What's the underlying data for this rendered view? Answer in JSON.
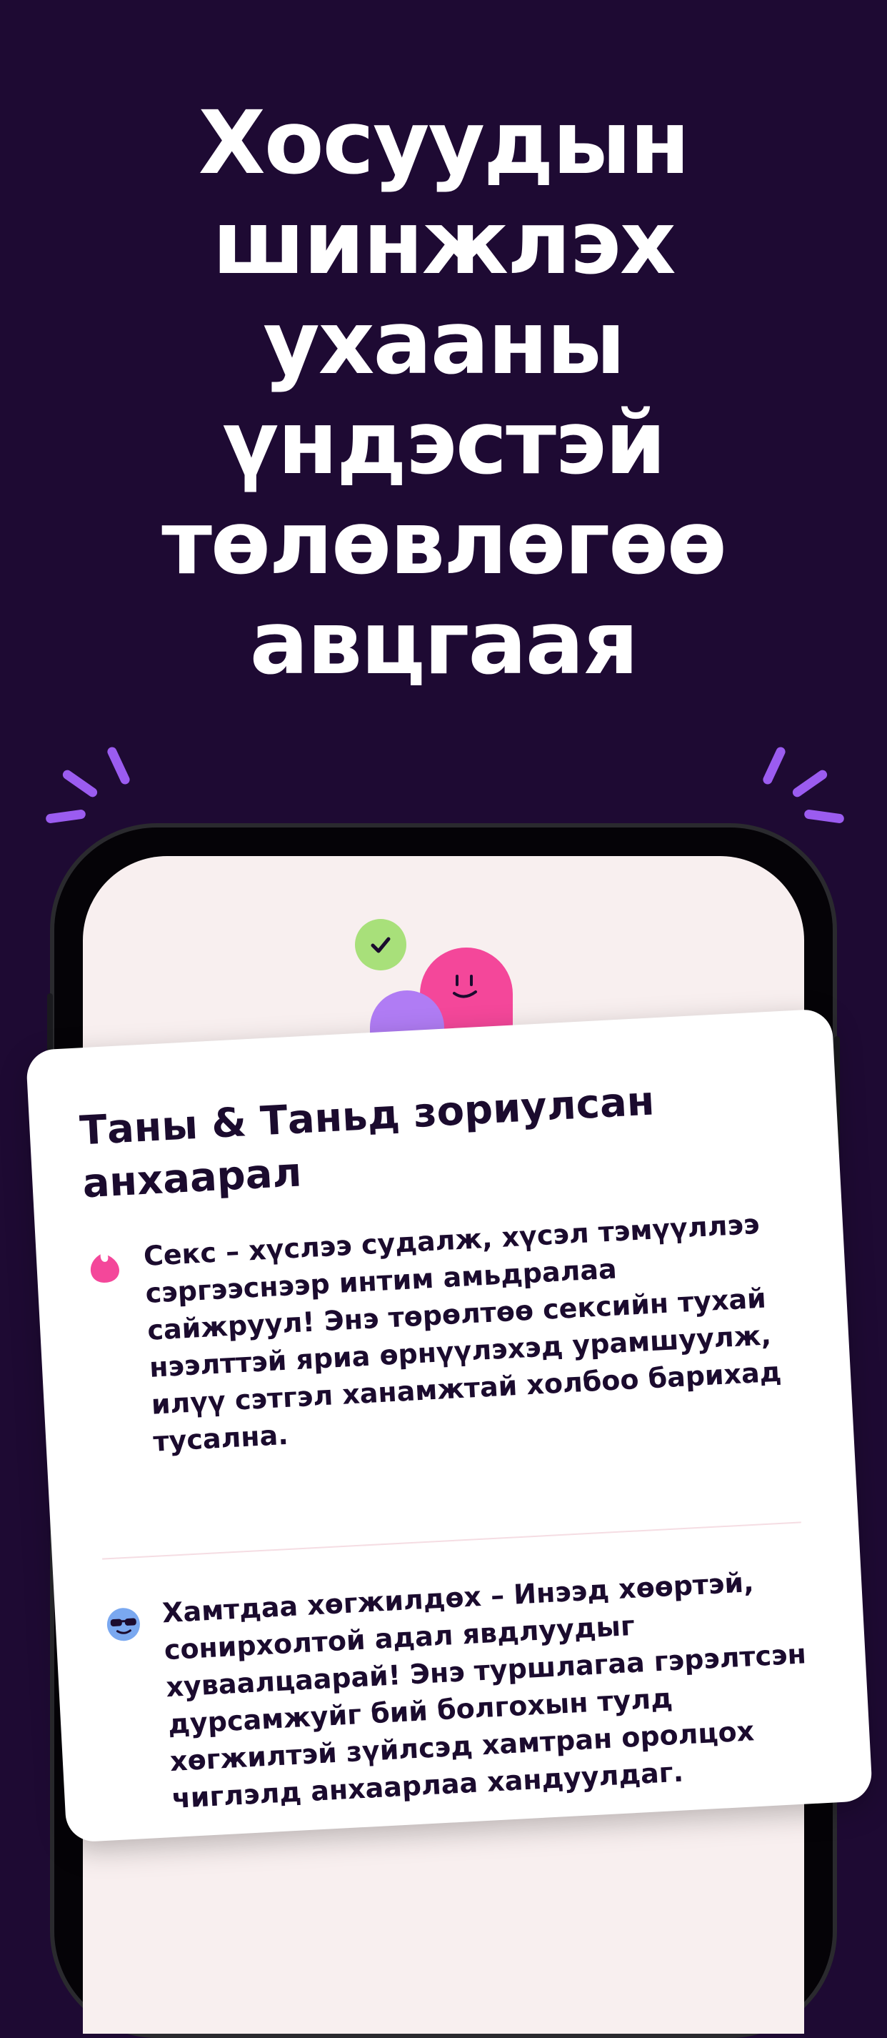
{
  "headline": {
    "line1": "Хосуудын",
    "line2": "шинжлэх",
    "line3": "ухааны",
    "line4": "үндэстэй",
    "line5": "төлөвлөгөө",
    "line6": "авцгаая"
  },
  "card": {
    "title": "Таны & Таньд зориулсан анхаарал",
    "items": [
      {
        "icon": "pink-flame-icon",
        "text": "Секс – хүслээ судалж, хүсэл тэмүүллээ сэргээснээр интим амьдралаа сайжруул! Энэ төрөлтөө сексийн тухай нээлттэй яриа өрнүүлэхэд урамшуулж, илүү сэтгэл ханамжтай холбоо барихад тусална."
      },
      {
        "icon": "sunglasses-face-icon",
        "text": "Хамтдаа хөгжилдөх – Инээд хөөртэй, сонирхолтой адал явдлуудыг хуваалцаарай! Энэ туршлагаа гэрэлтсэн дурсамжуйг бий болгохын тулд хөгжилтэй зүйлсэд хамтран оролцох чиглэлд анхаарлаа хандуулдаг."
      }
    ]
  },
  "colors": {
    "background": "#1e0a33",
    "accent_purple": "#9b5cf0",
    "pink": "#f4479a",
    "green": "#a8e07a",
    "blue": "#7aa8f0"
  }
}
